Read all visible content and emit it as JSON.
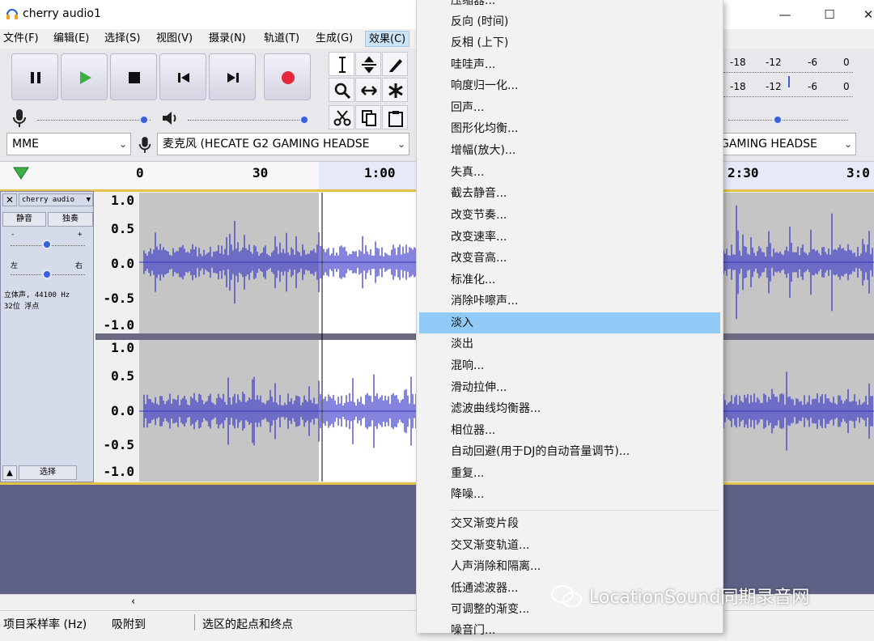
{
  "window": {
    "title": "cherry audio1",
    "controls": [
      "minimize-icon",
      "maximize-icon",
      "close-icon"
    ]
  },
  "menubar": {
    "items": [
      {
        "label": "文件(F)"
      },
      {
        "label": "编辑(E)"
      },
      {
        "label": "选择(S)"
      },
      {
        "label": "视图(V)"
      },
      {
        "label": "摄录(N)"
      },
      {
        "label": "轨道(T)"
      },
      {
        "label": "生成(G)"
      },
      {
        "label": "效果(C)"
      }
    ],
    "active": "效果(C)"
  },
  "transport": {
    "icons": [
      "pause-icon",
      "play-icon",
      "stop-icon",
      "skip-start-icon",
      "skip-end-icon",
      "record-icon"
    ],
    "record_color": "#e8283a",
    "play_color": "#3cb043"
  },
  "tools": {
    "icons": [
      "select-tool-icon",
      "envelope-tool-icon",
      "draw-tool-icon",
      "zoom-tool-icon",
      "timeshift-tool-icon",
      "multi-tool-icon",
      "cut-icon",
      "copy-icon",
      "paste-icon"
    ]
  },
  "meters": {
    "ticks": [
      "-18",
      "-12",
      "-6",
      "0"
    ]
  },
  "devices": {
    "host": "MME",
    "mic": "麦克风 (HECATE G2 GAMING HEADSE",
    "output": "GAMING HEADSE"
  },
  "timeline": {
    "labels": [
      "0",
      "30",
      "1:00",
      "2:30",
      "3:0"
    ]
  },
  "track": {
    "name": "cherry audio",
    "mute_label": "静音",
    "solo_label": "独奏",
    "gain_minus": "-",
    "gain_plus": "+",
    "pan_left": "左",
    "pan_right": "右",
    "info_line1": "立体声, 44100 Hz",
    "info_line2": "32位 浮点",
    "select_label": "选择",
    "scale": [
      "1.0",
      "0.5",
      "0.0",
      "-0.5",
      "-1.0"
    ],
    "wave_color": "#3232c8"
  },
  "status": {
    "sample_rate_label": "项目采样率 (Hz)",
    "snap_label": "吸附到",
    "selection_label": "选区的起点和终点"
  },
  "effects_menu": {
    "items": [
      "压缩器...",
      "反向 (时间)",
      "反相 (上下)",
      "哇哇声...",
      "响度归一化...",
      "回声...",
      "图形化均衡...",
      "增幅(放大)...",
      "失真...",
      "截去静音...",
      "改变节奏...",
      "改变速率...",
      "改变音高...",
      "标准化...",
      "消除咔嚓声...",
      "淡入",
      "淡出",
      "混响...",
      "滑动拉伸...",
      "滤波曲线均衡器...",
      "相位器...",
      "自动回避(用于DJ的自动音量调节)...",
      "重复...",
      "降噪..."
    ],
    "items2": [
      "交叉渐变片段",
      "交叉渐变轨道...",
      "人声消除和隔离...",
      "低通滤波器...",
      "可调整的渐变...",
      "噪音门..."
    ],
    "highlighted": "淡入",
    "highlight_color": "#91c9f7"
  },
  "watermark": {
    "text": "LocationSound同期录音网"
  }
}
